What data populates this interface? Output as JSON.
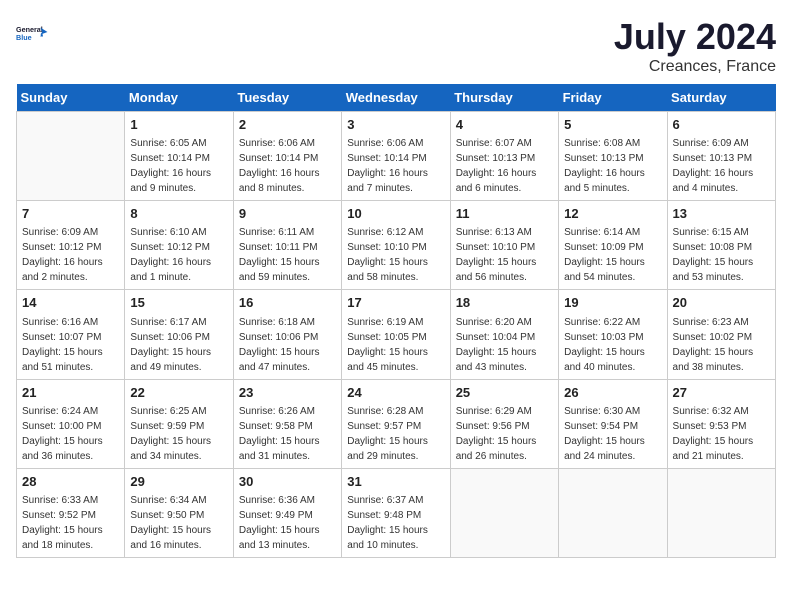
{
  "header": {
    "logo_line1": "General",
    "logo_line2": "Blue",
    "month": "July 2024",
    "location": "Creances, France"
  },
  "weekdays": [
    "Sunday",
    "Monday",
    "Tuesday",
    "Wednesday",
    "Thursday",
    "Friday",
    "Saturday"
  ],
  "weeks": [
    [
      {
        "day": "",
        "info": ""
      },
      {
        "day": "1",
        "info": "Sunrise: 6:05 AM\nSunset: 10:14 PM\nDaylight: 16 hours\nand 9 minutes."
      },
      {
        "day": "2",
        "info": "Sunrise: 6:06 AM\nSunset: 10:14 PM\nDaylight: 16 hours\nand 8 minutes."
      },
      {
        "day": "3",
        "info": "Sunrise: 6:06 AM\nSunset: 10:14 PM\nDaylight: 16 hours\nand 7 minutes."
      },
      {
        "day": "4",
        "info": "Sunrise: 6:07 AM\nSunset: 10:13 PM\nDaylight: 16 hours\nand 6 minutes."
      },
      {
        "day": "5",
        "info": "Sunrise: 6:08 AM\nSunset: 10:13 PM\nDaylight: 16 hours\nand 5 minutes."
      },
      {
        "day": "6",
        "info": "Sunrise: 6:09 AM\nSunset: 10:13 PM\nDaylight: 16 hours\nand 4 minutes."
      }
    ],
    [
      {
        "day": "7",
        "info": "Sunrise: 6:09 AM\nSunset: 10:12 PM\nDaylight: 16 hours\nand 2 minutes."
      },
      {
        "day": "8",
        "info": "Sunrise: 6:10 AM\nSunset: 10:12 PM\nDaylight: 16 hours\nand 1 minute."
      },
      {
        "day": "9",
        "info": "Sunrise: 6:11 AM\nSunset: 10:11 PM\nDaylight: 15 hours\nand 59 minutes."
      },
      {
        "day": "10",
        "info": "Sunrise: 6:12 AM\nSunset: 10:10 PM\nDaylight: 15 hours\nand 58 minutes."
      },
      {
        "day": "11",
        "info": "Sunrise: 6:13 AM\nSunset: 10:10 PM\nDaylight: 15 hours\nand 56 minutes."
      },
      {
        "day": "12",
        "info": "Sunrise: 6:14 AM\nSunset: 10:09 PM\nDaylight: 15 hours\nand 54 minutes."
      },
      {
        "day": "13",
        "info": "Sunrise: 6:15 AM\nSunset: 10:08 PM\nDaylight: 15 hours\nand 53 minutes."
      }
    ],
    [
      {
        "day": "14",
        "info": "Sunrise: 6:16 AM\nSunset: 10:07 PM\nDaylight: 15 hours\nand 51 minutes."
      },
      {
        "day": "15",
        "info": "Sunrise: 6:17 AM\nSunset: 10:06 PM\nDaylight: 15 hours\nand 49 minutes."
      },
      {
        "day": "16",
        "info": "Sunrise: 6:18 AM\nSunset: 10:06 PM\nDaylight: 15 hours\nand 47 minutes."
      },
      {
        "day": "17",
        "info": "Sunrise: 6:19 AM\nSunset: 10:05 PM\nDaylight: 15 hours\nand 45 minutes."
      },
      {
        "day": "18",
        "info": "Sunrise: 6:20 AM\nSunset: 10:04 PM\nDaylight: 15 hours\nand 43 minutes."
      },
      {
        "day": "19",
        "info": "Sunrise: 6:22 AM\nSunset: 10:03 PM\nDaylight: 15 hours\nand 40 minutes."
      },
      {
        "day": "20",
        "info": "Sunrise: 6:23 AM\nSunset: 10:02 PM\nDaylight: 15 hours\nand 38 minutes."
      }
    ],
    [
      {
        "day": "21",
        "info": "Sunrise: 6:24 AM\nSunset: 10:00 PM\nDaylight: 15 hours\nand 36 minutes."
      },
      {
        "day": "22",
        "info": "Sunrise: 6:25 AM\nSunset: 9:59 PM\nDaylight: 15 hours\nand 34 minutes."
      },
      {
        "day": "23",
        "info": "Sunrise: 6:26 AM\nSunset: 9:58 PM\nDaylight: 15 hours\nand 31 minutes."
      },
      {
        "day": "24",
        "info": "Sunrise: 6:28 AM\nSunset: 9:57 PM\nDaylight: 15 hours\nand 29 minutes."
      },
      {
        "day": "25",
        "info": "Sunrise: 6:29 AM\nSunset: 9:56 PM\nDaylight: 15 hours\nand 26 minutes."
      },
      {
        "day": "26",
        "info": "Sunrise: 6:30 AM\nSunset: 9:54 PM\nDaylight: 15 hours\nand 24 minutes."
      },
      {
        "day": "27",
        "info": "Sunrise: 6:32 AM\nSunset: 9:53 PM\nDaylight: 15 hours\nand 21 minutes."
      }
    ],
    [
      {
        "day": "28",
        "info": "Sunrise: 6:33 AM\nSunset: 9:52 PM\nDaylight: 15 hours\nand 18 minutes."
      },
      {
        "day": "29",
        "info": "Sunrise: 6:34 AM\nSunset: 9:50 PM\nDaylight: 15 hours\nand 16 minutes."
      },
      {
        "day": "30",
        "info": "Sunrise: 6:36 AM\nSunset: 9:49 PM\nDaylight: 15 hours\nand 13 minutes."
      },
      {
        "day": "31",
        "info": "Sunrise: 6:37 AM\nSunset: 9:48 PM\nDaylight: 15 hours\nand 10 minutes."
      },
      {
        "day": "",
        "info": ""
      },
      {
        "day": "",
        "info": ""
      },
      {
        "day": "",
        "info": ""
      }
    ]
  ]
}
